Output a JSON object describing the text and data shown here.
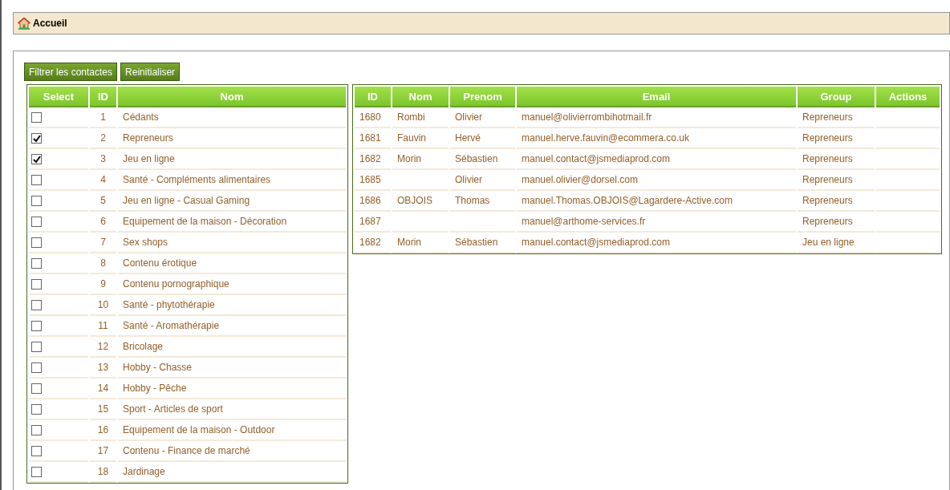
{
  "breadcrumb": {
    "label": "Accueil"
  },
  "buttons": [
    {
      "label": "Filtrer les contactes"
    },
    {
      "label": "Reinitialiser"
    }
  ],
  "groups_table": {
    "columns": [
      "Select",
      "ID",
      "Nom"
    ],
    "rows": [
      {
        "checked": false,
        "id": "1",
        "nom": "Cédants"
      },
      {
        "checked": true,
        "id": "2",
        "nom": "Repreneurs"
      },
      {
        "checked": true,
        "id": "3",
        "nom": "Jeu en ligne"
      },
      {
        "checked": false,
        "id": "4",
        "nom": "Santé - Compléments alimentaires"
      },
      {
        "checked": false,
        "id": "5",
        "nom": "Jeu en ligne - Casual Gaming"
      },
      {
        "checked": false,
        "id": "6",
        "nom": "Equipement de la maison - Décoration"
      },
      {
        "checked": false,
        "id": "7",
        "nom": "Sex shops"
      },
      {
        "checked": false,
        "id": "8",
        "nom": "Contenu érotique"
      },
      {
        "checked": false,
        "id": "9",
        "nom": "Contenu pornographique"
      },
      {
        "checked": false,
        "id": "10",
        "nom": "Santé - phytothérapie"
      },
      {
        "checked": false,
        "id": "11",
        "nom": "Santé - Aromathérapie"
      },
      {
        "checked": false,
        "id": "12",
        "nom": "Bricolage"
      },
      {
        "checked": false,
        "id": "13",
        "nom": "Hobby - Chasse"
      },
      {
        "checked": false,
        "id": "14",
        "nom": "Hobby - Pêche"
      },
      {
        "checked": false,
        "id": "15",
        "nom": "Sport - Articles de sport"
      },
      {
        "checked": false,
        "id": "16",
        "nom": "Equipement de la maison - Outdoor"
      },
      {
        "checked": false,
        "id": "17",
        "nom": "Contenu - Finance de marché"
      },
      {
        "checked": false,
        "id": "18",
        "nom": "Jardinage"
      }
    ]
  },
  "contacts_table": {
    "columns": [
      "ID",
      "Nom",
      "Prenom",
      "Email",
      "Group",
      "Actions"
    ],
    "rows": [
      {
        "id": "1680",
        "nom": "Rombi",
        "prenom": "Olivier",
        "email": "manuel@olivierrombihotmail.fr",
        "group": "Repreneurs"
      },
      {
        "id": "1681",
        "nom": "Fauvin",
        "prenom": "Hervé",
        "email": "manuel.herve.fauvin@ecommera.co.uk",
        "group": "Repreneurs"
      },
      {
        "id": "1682",
        "nom": "Morin",
        "prenom": "Sébastien",
        "email": "manuel.contact@jsmediaprod.com",
        "group": "Repreneurs"
      },
      {
        "id": "1685",
        "prenom": "Olivier",
        "email": "manuel.olivier@dorsel.com",
        "group": "Repreneurs"
      },
      {
        "id": "1686",
        "nom": "OBJOIS",
        "prenom": "Thomas",
        "email": "manuel.Thomas.OBJOIS@Lagardere-Active.com",
        "group": "Repreneurs"
      },
      {
        "id": "1687",
        "email": "manuel@arthome-services.fr",
        "group": "Repreneurs"
      },
      {
        "id": "1682",
        "nom": "Morin",
        "prenom": "Sébastien",
        "email": "manuel.contact@jsmediaprod.com",
        "group": "Jeu en ligne"
      }
    ]
  }
}
